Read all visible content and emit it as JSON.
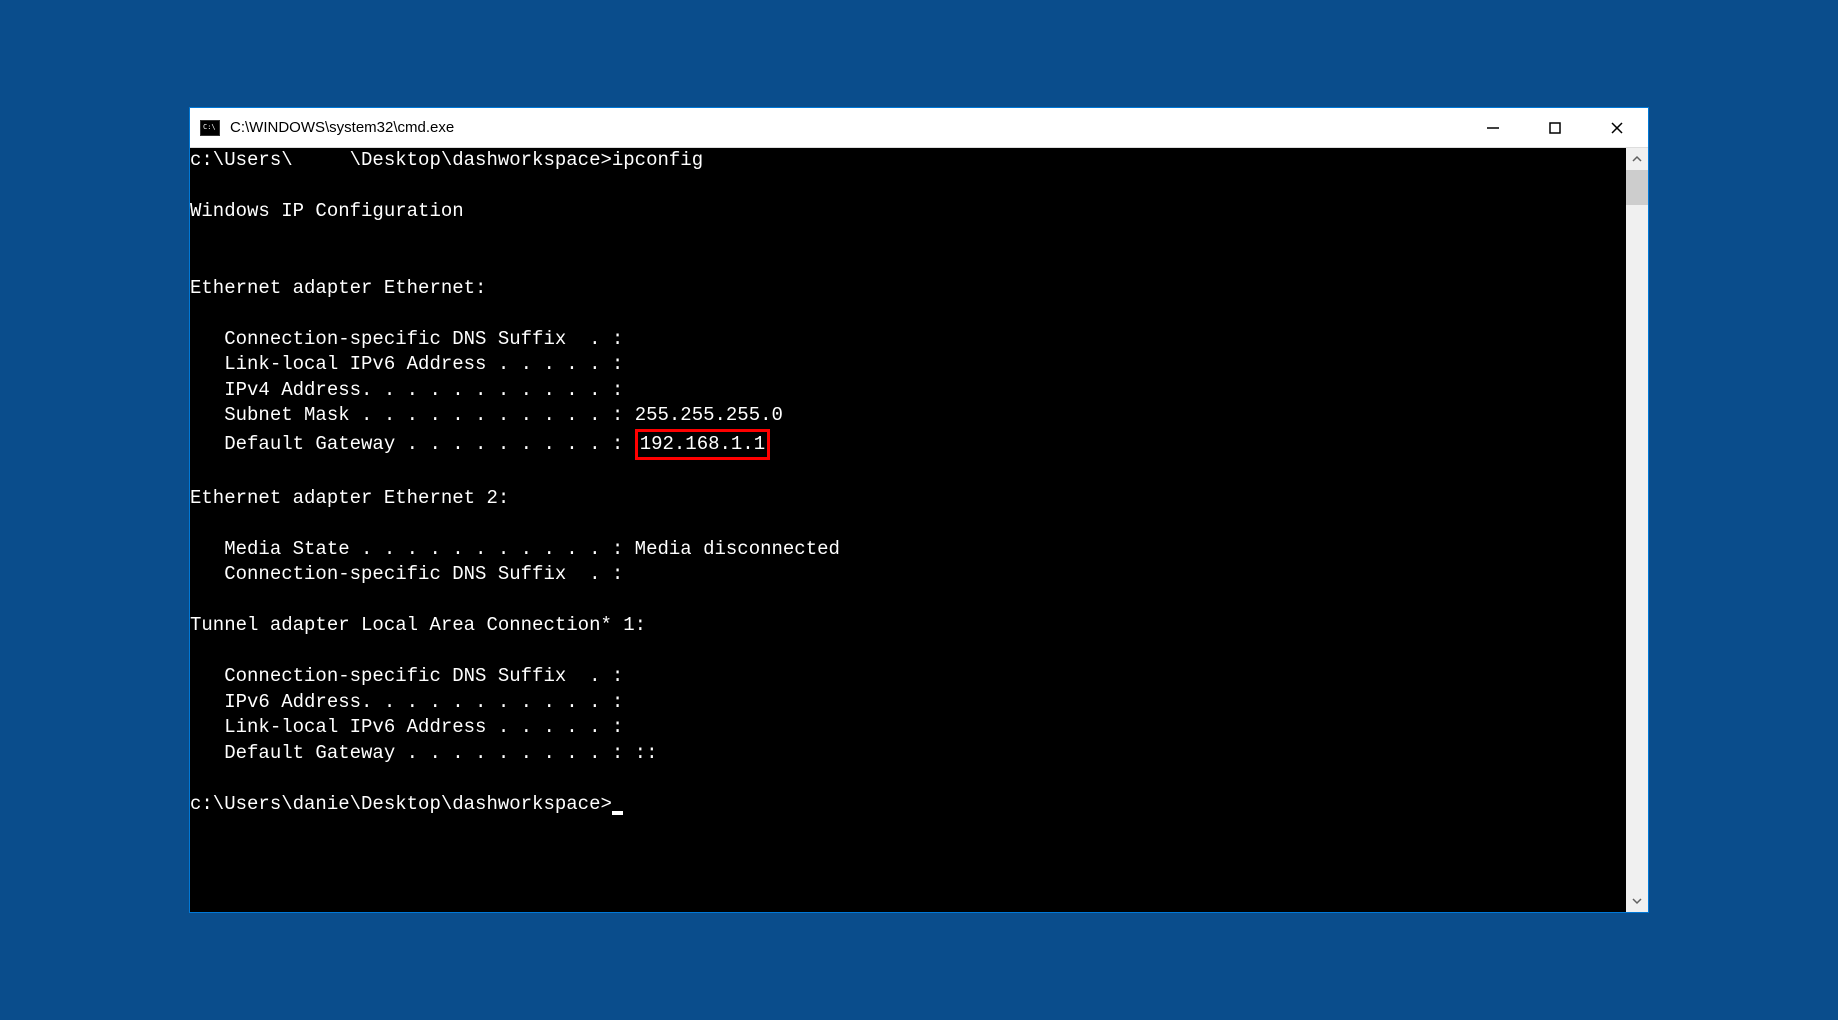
{
  "window": {
    "title": "C:\\WINDOWS\\system32\\cmd.exe",
    "icon_label": "C:\\"
  },
  "terminal": {
    "prompt1_path": "c:\\Users\\     \\Desktop\\dashworkspace>",
    "prompt1_cmd": "ipconfig",
    "header": "Windows IP Configuration",
    "adapter1": {
      "title": "Ethernet adapter Ethernet:",
      "lines": {
        "dns_suffix": "   Connection-specific DNS Suffix  . :",
        "ipv6_link": "   Link-local IPv6 Address . . . . . :",
        "ipv4": "   IPv4 Address. . . . . . . . . . . :",
        "subnet_label": "   Subnet Mask . . . . . . . . . . . : ",
        "subnet_value": "255.255.255.0",
        "gateway_label": "   Default Gateway . . . . . . . . . : ",
        "gateway_value": "192.168.1.1"
      }
    },
    "adapter2": {
      "title": "Ethernet adapter Ethernet 2:",
      "lines": {
        "media_state": "   Media State . . . . . . . . . . . : Media disconnected",
        "dns_suffix": "   Connection-specific DNS Suffix  . :"
      }
    },
    "adapter3": {
      "title": "Tunnel adapter Local Area Connection* 1:",
      "lines": {
        "dns_suffix": "   Connection-specific DNS Suffix  . :",
        "ipv6": "   IPv6 Address. . . . . . . . . . . :",
        "ipv6_link": "   Link-local IPv6 Address . . . . . :",
        "gateway": "   Default Gateway . . . . . . . . . : ::"
      }
    },
    "prompt2_path": "c:\\Users\\danie\\Desktop\\dashworkspace>"
  }
}
